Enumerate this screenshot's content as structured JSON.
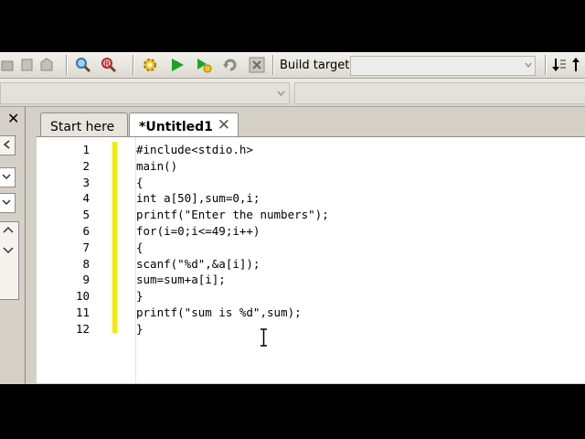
{
  "toolbar": {
    "build_target_label": "Build target:",
    "build_target_value": ""
  },
  "editor": {
    "tabs": [
      {
        "label": "Start here",
        "active": false
      },
      {
        "label": "*Untitled1",
        "active": true
      }
    ],
    "line_numbers": [
      "1",
      "2",
      "3",
      "4",
      "5",
      "6",
      "7",
      "8",
      "9",
      "10",
      "11",
      "12"
    ],
    "code": [
      "#include<stdio.h>",
      "main()",
      "{",
      "int a[50],sum=0,i;",
      "printf(\"Enter the numbers\");",
      "for(i=0;i<=49;i++)",
      "{",
      "scanf(\"%d\",&a[i]);",
      "sum=sum+a[i];",
      "}",
      "printf(\"sum is %d\",sum);",
      "}"
    ]
  },
  "colors": {
    "change_bar": "#f4ea00",
    "window_bg": "#d4d0c8"
  },
  "icons": [
    "search-icon",
    "replace-icon",
    "gear-icon",
    "run-icon",
    "build-and-run-icon",
    "rebuild-icon",
    "abort-icon",
    "jump-icon"
  ]
}
